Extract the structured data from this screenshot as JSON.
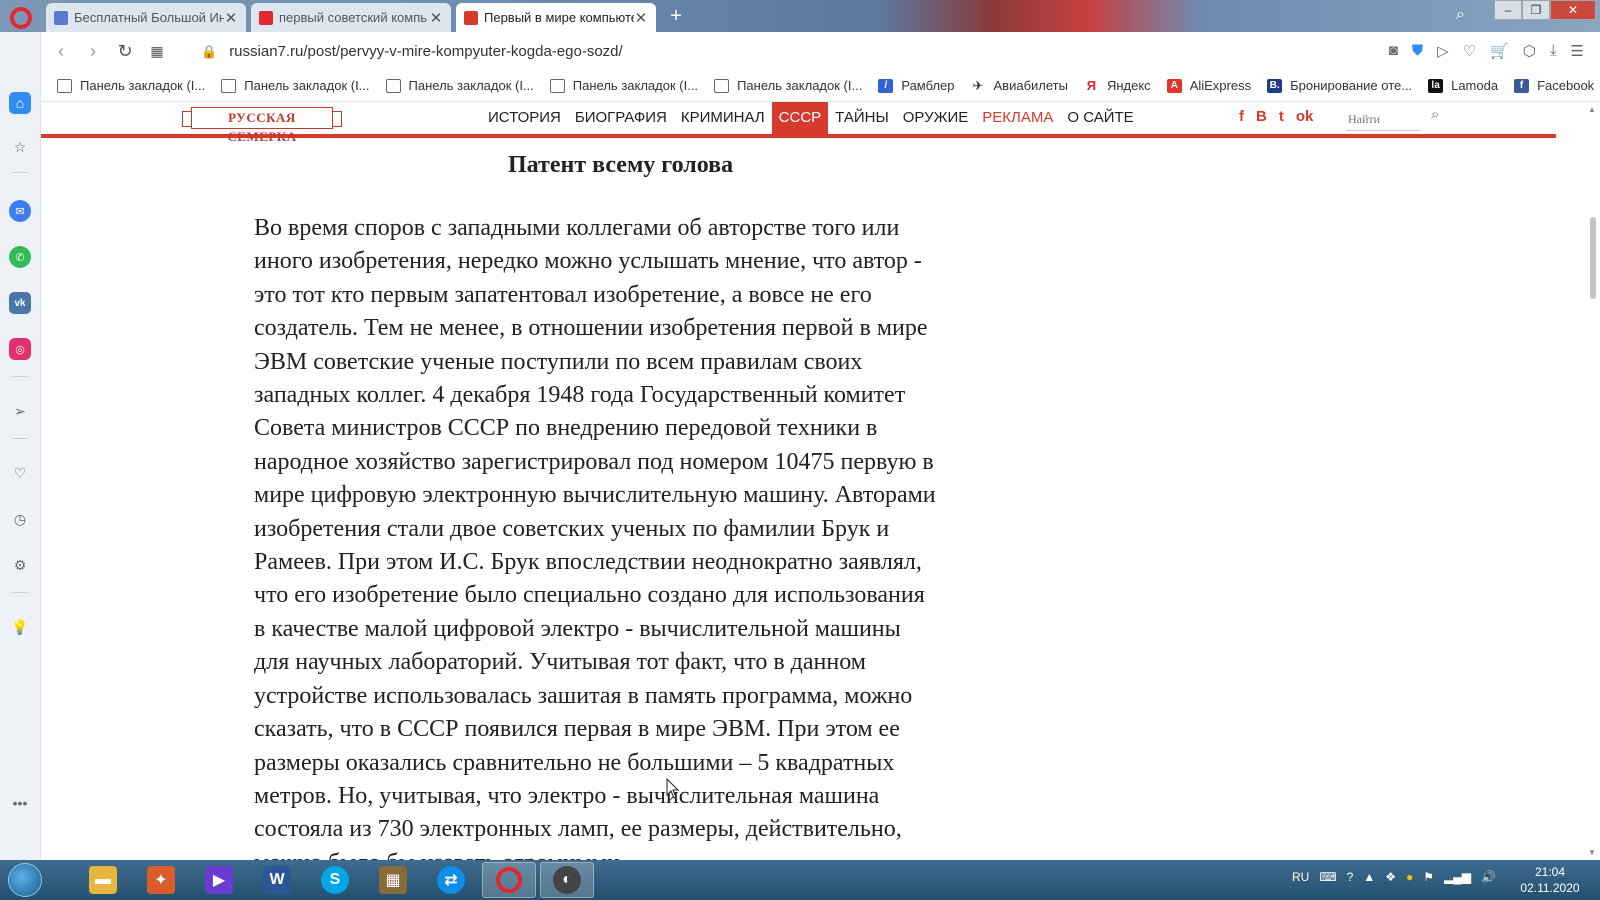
{
  "browser": {
    "tabs": [
      {
        "title": "Бесплатный Большой Инт",
        "favicon_color": "#5a7bd0"
      },
      {
        "title": "первый советский компь",
        "favicon_color": "#e0282e"
      },
      {
        "title": "Первый в мире компьюте",
        "favicon_color": "#d53a2d"
      }
    ],
    "address": {
      "url": "russian7.ru/post/pervyy-v-mire-kompyuter-kogda-ego-sozd/"
    },
    "bookmarks": [
      {
        "label": "Панель закладок (I...",
        "kind": "folder"
      },
      {
        "label": "Панель закладок (I...",
        "kind": "folder"
      },
      {
        "label": "Панель закладок (I...",
        "kind": "folder"
      },
      {
        "label": "Панель закладок (I...",
        "kind": "folder"
      },
      {
        "label": "Панель закладок (I...",
        "kind": "folder"
      },
      {
        "label": "Рамблер",
        "kind": "site",
        "color": "#3163d6",
        "glyph": "/"
      },
      {
        "label": "Авиабилеты",
        "kind": "site",
        "color": "#ffffff",
        "glyph": "✈"
      },
      {
        "label": "Яндекс",
        "kind": "site",
        "color": "#ffffff",
        "glyph": "Я"
      },
      {
        "label": "AliExpress",
        "kind": "site",
        "color": "#e4342a",
        "glyph": "A"
      },
      {
        "label": "Бронирование оте...",
        "kind": "site",
        "color": "#1f3c88",
        "glyph": "B."
      },
      {
        "label": "Lamoda",
        "kind": "site",
        "color": "#111111",
        "glyph": "la"
      },
      {
        "label": "Facebook",
        "kind": "site",
        "color": "#3b5998",
        "glyph": "f"
      }
    ]
  },
  "site": {
    "logo_text": "РУССКАЯ СЕМЕРКА",
    "nav": [
      {
        "label": "ИСТОРИЯ",
        "state": "normal"
      },
      {
        "label": "БИОГРАФИЯ",
        "state": "normal"
      },
      {
        "label": "КРИМИНАЛ",
        "state": "normal"
      },
      {
        "label": "СССР",
        "state": "active"
      },
      {
        "label": "ТАЙНЫ",
        "state": "normal"
      },
      {
        "label": "ОРУЖИЕ",
        "state": "normal"
      },
      {
        "label": "РЕКЛАМА",
        "state": "ad"
      },
      {
        "label": "О САЙТЕ",
        "state": "normal"
      }
    ],
    "social": [
      "f",
      "B",
      "t",
      "ok"
    ],
    "search_placeholder": "Найти"
  },
  "article": {
    "heading": "Патент всему голова",
    "body": "Во время споров с западными коллегами об авторстве того или\nиного изобретения, нередко можно услышать мнение, что автор -\nэто тот кто первым запатентовал изобретение, а вовсе не его\nсоздатель. Тем не менее, в отношении изобретения первой в мире\nЭВМ советские ученые поступили по всем правилам своих\nзападных коллег. 4 декабря 1948 года Государственный комитет\nСовета министров СССР по внедрению передовой техники в\nнародное хозяйство зарегистрировал под номером 10475 первую в\nмире цифровую электронную вычислительную машину. Авторами\nизобретения стали двое советских ученых по фамилии Брук и\nРамеев. При этом И.С. Брук впоследствии неоднократно заявлял,\nчто его изобретение было специально создано для использования\nв качестве малой цифровой электро - вычислительной машины\nдля научных лабораторий. Учитывая тот факт, что в данном\nустройстве использовалась зашитая в память программа, можно\nсказать, что в СССР появился первая в мире ЭВМ. При этом ее\nразмеры оказались сравнительно не большими – 5 квадратных\nметров. Но, учитывая, что электро - вычислительная машина\nсостояла из 730 электронных ламп, ее размеры, действительно,\nможно было бы назвать огромными."
  },
  "taskbar": {
    "apps": [
      {
        "name": "explorer",
        "color": "#e8b640",
        "glyph": "▬",
        "active": false
      },
      {
        "name": "app-2",
        "color": "#d95c2a",
        "glyph": "✦",
        "active": false
      },
      {
        "name": "app-3",
        "color": "#6a3bd1",
        "glyph": "▶",
        "active": false
      },
      {
        "name": "word",
        "color": "#2b5797",
        "glyph": "W",
        "active": false
      },
      {
        "name": "skype",
        "color": "#00a7e7",
        "glyph": "S",
        "active": false
      },
      {
        "name": "app-6",
        "color": "#8a6a3a",
        "glyph": "▦",
        "active": false
      },
      {
        "name": "teamviewer",
        "color": "#0e8ee9",
        "glyph": "⇄",
        "active": false
      },
      {
        "name": "opera",
        "color": "#e0282e",
        "glyph": "O",
        "active": true
      },
      {
        "name": "app-9",
        "color": "#444444",
        "glyph": "◐",
        "active": true
      }
    ],
    "language": "RU",
    "time": "21:04",
    "date": "02.11.2020"
  }
}
